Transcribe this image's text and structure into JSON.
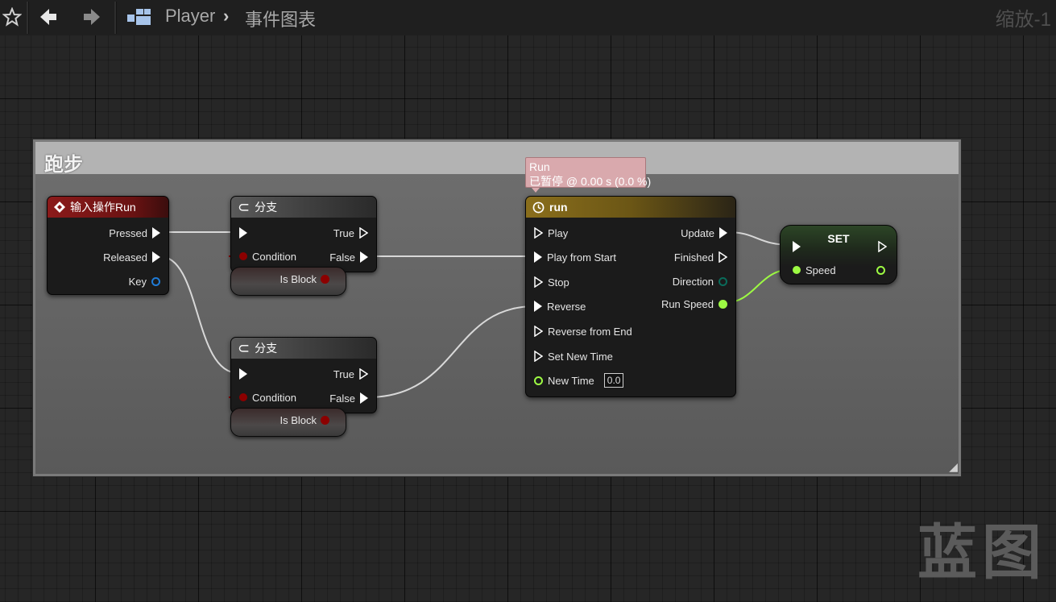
{
  "toolbar": {
    "breadcrumb_root": "Player",
    "breadcrumb_separator": "›",
    "breadcrumb_current": "事件图表",
    "zoom_label": "缩放-1"
  },
  "comment": {
    "title": "跑步"
  },
  "nodes": {
    "input_action": {
      "title": "输入操作Run",
      "pins": {
        "pressed": "Pressed",
        "released": "Released",
        "key": "Key"
      }
    },
    "branch_top": {
      "title": "分支",
      "pins": {
        "true": "True",
        "condition": "Condition",
        "false": "False"
      },
      "sub_node": "Is Block"
    },
    "branch_bottom": {
      "title": "分支",
      "pins": {
        "true": "True",
        "condition": "Condition",
        "false": "False"
      },
      "sub_node": "Is Block"
    },
    "timeline": {
      "title": "run",
      "inputs": [
        "Play",
        "Play from Start",
        "Stop",
        "Reverse",
        "Reverse from End",
        "Set New Time"
      ],
      "new_time_label": "New Time",
      "new_time_value": "0.0",
      "outputs": [
        "Update",
        "Finished",
        "Direction",
        "Run Speed"
      ]
    },
    "set": {
      "title": "SET",
      "speed_label": "Speed"
    }
  },
  "debug_tooltip": {
    "line1": "Run",
    "line2": "已暂停 @ 0.00 s (0.0 %)"
  },
  "watermark": "蓝图",
  "colors": {
    "exec": "#ffffff",
    "bool": "#8c0000",
    "float": "#9dfa43",
    "struct": "#1f7bd6",
    "enum": "#0a6b5a",
    "input_header": "#8b1a1a",
    "branch_header": "#4d4d4d",
    "timeline_header": "#8a6e1c",
    "set_header": "#6f8c5a"
  }
}
